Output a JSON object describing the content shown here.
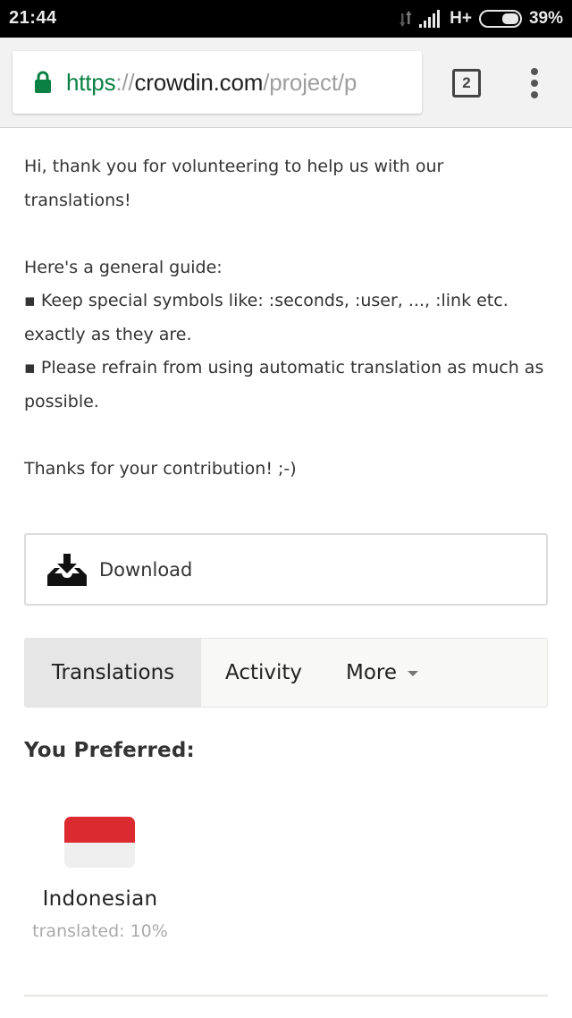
{
  "status_bar": {
    "time": "21:44",
    "network": "H+",
    "battery_percent": "39%",
    "battery_level": 0.39
  },
  "browser": {
    "url_scheme": "https",
    "url_separator": "://",
    "url_host": "crowdin.com",
    "url_path": "/project/p",
    "tab_count": "2"
  },
  "intro": {
    "greeting": "Hi, thank you for volunteering to help us with our translations!",
    "guide_heading": "Here's a general guide:",
    "rules": [
      "▪ Keep special symbols like: :seconds, :user, ..., :link etc. exactly as they are.",
      "▪ Please refrain from using automatic translation as much as possible."
    ],
    "thanks": "Thanks for your contribution! ;-)"
  },
  "download": {
    "label": "Download"
  },
  "tabs": [
    {
      "label": "Translations",
      "active": true
    },
    {
      "label": "Activity",
      "active": false
    },
    {
      "label": "More",
      "active": false
    }
  ],
  "preferred": {
    "title": "You Preferred:",
    "languages": [
      {
        "name": "Indonesian",
        "progress_text": "translated: 10%",
        "flag_colors": [
          "#dc2b30",
          "#efefef"
        ]
      }
    ]
  },
  "colors": {
    "secure_green": "#0b8043",
    "active_tab_bg": "#e6e6e6"
  }
}
